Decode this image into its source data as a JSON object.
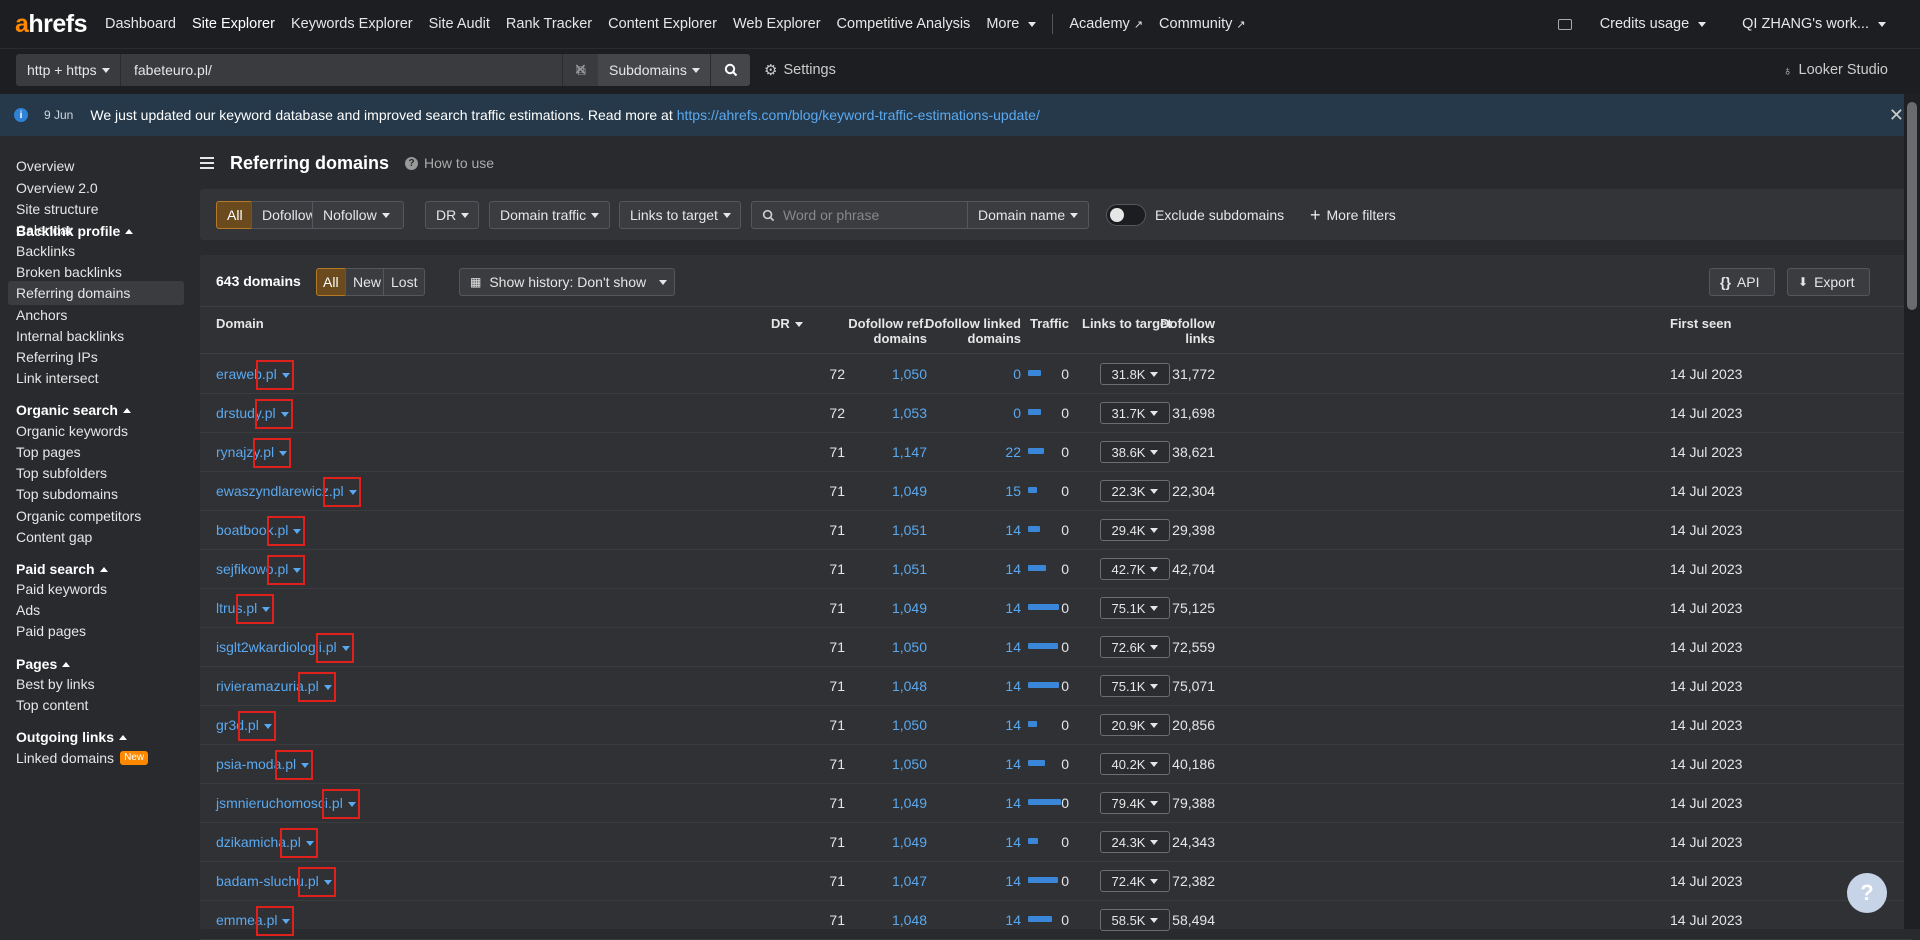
{
  "nav": {
    "logo_a": "a",
    "logo_rest": "hrefs",
    "items": [
      "Dashboard",
      "Site Explorer",
      "Keywords Explorer",
      "Site Audit",
      "Rank Tracker",
      "Content Explorer",
      "Web Explorer",
      "Competitive Analysis",
      "More"
    ],
    "academy": "Academy",
    "community": "Community",
    "credits": "Credits usage",
    "workspace": "QI ZHANG's work..."
  },
  "urlbar": {
    "protocol": "http + https",
    "url": "fabeteuro.pl/",
    "mode": "Subdomains",
    "settings": "Settings",
    "looker": "Looker Studio"
  },
  "banner": {
    "date": "9 Jun",
    "message": "We just updated our keyword database and improved search traffic estimations. Read more at",
    "link": "https://ahrefs.com/blog/keyword-traffic-estimations-update/"
  },
  "sidebar": {
    "top": [
      "Overview",
      "Overview 2.0",
      "Site structure",
      "Calendar"
    ],
    "backlink_head": "Backlink profile",
    "backlink": [
      "Backlinks",
      "Broken backlinks",
      "Referring domains",
      "Anchors",
      "Internal backlinks",
      "Referring IPs",
      "Link intersect"
    ],
    "organic_head": "Organic search",
    "organic": [
      "Organic keywords",
      "Top pages",
      "Top subfolders",
      "Top subdomains",
      "Organic competitors",
      "Content gap"
    ],
    "paid_head": "Paid search",
    "paid": [
      "Paid keywords",
      "Ads",
      "Paid pages"
    ],
    "pages_head": "Pages",
    "pages": [
      "Best by links",
      "Top content"
    ],
    "outgoing_head": "Outgoing links",
    "outgoing": [
      "Linked domains"
    ],
    "new_badge": "New"
  },
  "page": {
    "title": "Referring domains",
    "howto": "How to use"
  },
  "filters": {
    "all": "All",
    "dofollow": "Dofollow",
    "nofollow": "Nofollow",
    "dr": "DR",
    "domain_traffic": "Domain traffic",
    "links_to_target": "Links to target",
    "search_placeholder": "Word or phrase",
    "domain_name": "Domain name",
    "exclude_subdomains": "Exclude subdomains",
    "more_filters": "More filters"
  },
  "table": {
    "count": "643 domains",
    "tabs": [
      "All",
      "New",
      "Lost"
    ],
    "history": "Show history: Don't show",
    "api": "API",
    "export": "Export",
    "headers": {
      "domain": "Domain",
      "dr": "DR",
      "ref1": "Dofollow ref.",
      "ref2": "domains",
      "linked1": "Dofollow linked",
      "linked2": "domains",
      "traffic": "Traffic",
      "ltt": "Links to target",
      "dl1": "Dofollow",
      "dl2": "links",
      "first_seen": "First seen"
    },
    "rows": [
      {
        "domain": "eraweb.pl",
        "dr": "72",
        "ref": "1,050",
        "linked": "0",
        "traffic": "0",
        "ltt": "31.8K",
        "links": "31,772",
        "bar": 0.13,
        "first": "14 Jul 2023"
      },
      {
        "domain": "drstudy.pl",
        "dr": "72",
        "ref": "1,053",
        "linked": "0",
        "traffic": "0",
        "ltt": "31.7K",
        "links": "31,698",
        "bar": 0.13,
        "first": "14 Jul 2023"
      },
      {
        "domain": "rynajzy.pl",
        "dr": "71",
        "ref": "1,147",
        "linked": "22",
        "traffic": "0",
        "ltt": "38.6K",
        "links": "38,621",
        "bar": 0.16,
        "first": "14 Jul 2023"
      },
      {
        "domain": "ewaszyndlarewicz.pl",
        "dr": "71",
        "ref": "1,049",
        "linked": "15",
        "traffic": "0",
        "ltt": "22.3K",
        "links": "22,304",
        "bar": 0.09,
        "first": "14 Jul 2023"
      },
      {
        "domain": "boatbook.pl",
        "dr": "71",
        "ref": "1,051",
        "linked": "14",
        "traffic": "0",
        "ltt": "29.4K",
        "links": "29,398",
        "bar": 0.12,
        "first": "14 Jul 2023"
      },
      {
        "domain": "sejfikowo.pl",
        "dr": "71",
        "ref": "1,051",
        "linked": "14",
        "traffic": "0",
        "ltt": "42.7K",
        "links": "42,704",
        "bar": 0.18,
        "first": "14 Jul 2023"
      },
      {
        "domain": "ltrus.pl",
        "dr": "71",
        "ref": "1,049",
        "linked": "14",
        "traffic": "0",
        "ltt": "75.1K",
        "links": "75,125",
        "bar": 0.31,
        "first": "14 Jul 2023"
      },
      {
        "domain": "isglt2wkardiologii.pl",
        "dr": "71",
        "ref": "1,050",
        "linked": "14",
        "traffic": "0",
        "ltt": "72.6K",
        "links": "72,559",
        "bar": 0.3,
        "first": "14 Jul 2023"
      },
      {
        "domain": "rivieramazuria.pl",
        "dr": "71",
        "ref": "1,048",
        "linked": "14",
        "traffic": "0",
        "ltt": "75.1K",
        "links": "75,071",
        "bar": 0.31,
        "first": "14 Jul 2023"
      },
      {
        "domain": "gr3d.pl",
        "dr": "71",
        "ref": "1,050",
        "linked": "14",
        "traffic": "0",
        "ltt": "20.9K",
        "links": "20,856",
        "bar": 0.09,
        "first": "14 Jul 2023"
      },
      {
        "domain": "psia-moda.pl",
        "dr": "71",
        "ref": "1,050",
        "linked": "14",
        "traffic": "0",
        "ltt": "40.2K",
        "links": "40,186",
        "bar": 0.17,
        "first": "14 Jul 2023"
      },
      {
        "domain": "jsmnieruchomosci.pl",
        "dr": "71",
        "ref": "1,049",
        "linked": "14",
        "traffic": "0",
        "ltt": "79.4K",
        "links": "79,388",
        "bar": 0.33,
        "first": "14 Jul 2023"
      },
      {
        "domain": "dzikamicha.pl",
        "dr": "71",
        "ref": "1,049",
        "linked": "14",
        "traffic": "0",
        "ltt": "24.3K",
        "links": "24,343",
        "bar": 0.1,
        "first": "14 Jul 2023"
      },
      {
        "domain": "badam-sluchu.pl",
        "dr": "71",
        "ref": "1,047",
        "linked": "14",
        "traffic": "0",
        "ltt": "72.4K",
        "links": "72,382",
        "bar": 0.3,
        "first": "14 Jul 2023"
      },
      {
        "domain": "emmea.pl",
        "dr": "71",
        "ref": "1,048",
        "linked": "14",
        "traffic": "0",
        "ltt": "58.5K",
        "links": "58,494",
        "bar": 0.24,
        "first": "14 Jul 2023"
      }
    ]
  },
  "colors": {
    "accent": "#ff8800",
    "link": "#5aa9f0",
    "bar": "#3a86d8",
    "highlight": "#e0201b"
  },
  "help": "?"
}
